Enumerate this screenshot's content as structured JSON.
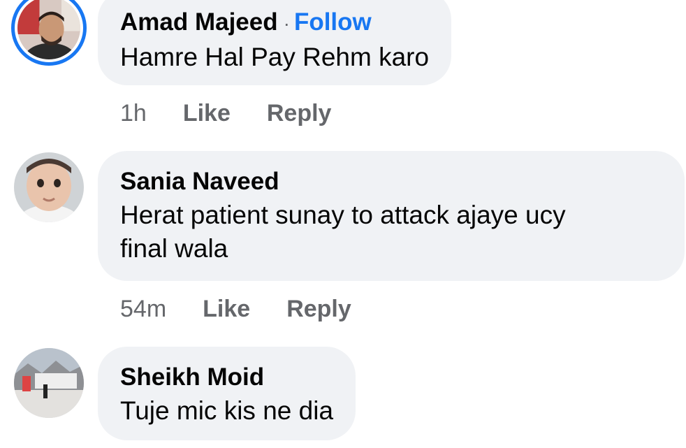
{
  "comments": [
    {
      "author": "Amad Majeed",
      "separator": "·",
      "follow_label": "Follow",
      "text_lines": [
        "Hamre Hal Pay Rehm karo"
      ],
      "time": "1h",
      "like_label": "Like",
      "reply_label": "Reply",
      "avatar_icon": "profile-photo-man",
      "avatar_ring_color": "#1877f2"
    },
    {
      "author": "Sania Naveed",
      "text_lines": [
        "Herat patient sunay to attack ajaye ucy",
        "final wala"
      ],
      "time": "54m",
      "like_label": "Like",
      "reply_label": "Reply",
      "avatar_icon": "profile-photo-child"
    },
    {
      "author": "Sheikh Moid",
      "text_lines": [
        "Tuje mic kis ne dia"
      ],
      "avatar_icon": "profile-photo-landscape"
    }
  ],
  "colors": {
    "bubble_bg": "#f0f2f5",
    "link_blue": "#1877f2",
    "meta_gray": "#65676b",
    "text": "#050505"
  }
}
